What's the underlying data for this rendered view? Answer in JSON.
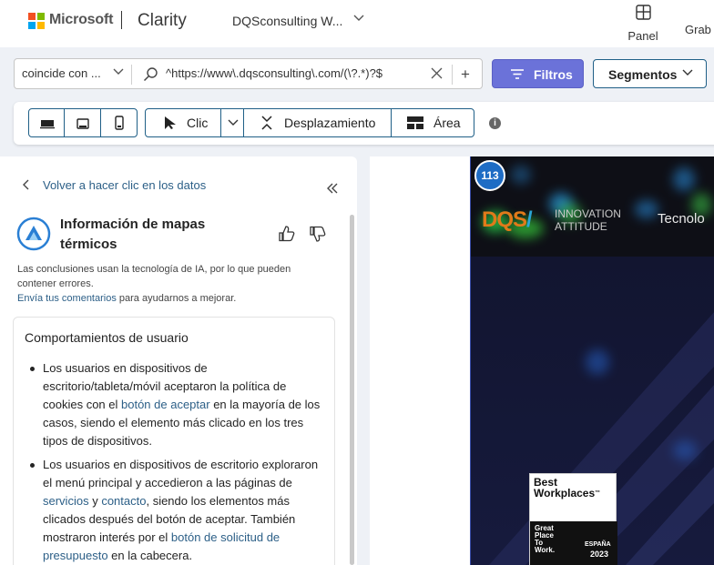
{
  "header": {
    "brand": "Microsoft",
    "product": "Clarity",
    "project_name": "DQSconsulting W...",
    "panel_label": "Panel",
    "recordings_label": "Grab"
  },
  "filters": {
    "match_type": "coincide con ...",
    "url_pattern": "^https://www\\.dqsconsulting\\.com/(\\?.*)?$",
    "add_symbol": "+",
    "filters_button": "Filtros",
    "segments_button": "Segmentos"
  },
  "toolbar": {
    "devices": [
      "desktop",
      "tablet",
      "mobile"
    ],
    "mode_click": "Clic",
    "mode_scroll": "Desplazamiento",
    "mode_area": "Área",
    "info_symbol": "i"
  },
  "panel": {
    "back_label": "Volver a hacer clic en los datos",
    "insights_title": "Información de mapas térmicos",
    "ai_note": "Las conclusiones usan la tecnología de IA, por lo que pueden contener errores.",
    "feedback_link": "Envía tus comentarios",
    "feedback_suffix": " para ayudarnos a mejorar.",
    "card_title": "Comportamientos de usuario",
    "bullet1_a": "Los usuarios en dispositivos de escritorio/tableta/móvil aceptaron la política de cookies con el ",
    "bullet1_link": "botón de aceptar",
    "bullet1_b": " en la mayoría de los casos, siendo el elemento más clicado en los tres tipos de dispositivos.",
    "bullet2_a": "Los usuarios en dispositivos de escritorio exploraron el menú principal y accedieron a las páginas de ",
    "bullet2_link1": "servicios",
    "bullet2_mid": " y ",
    "bullet2_link2": "contacto",
    "bullet2_b": ", siendo los elementos más clicados después del botón de aceptar. También mostraron interés por el ",
    "bullet2_link3": "botón de solicitud de presupuesto",
    "bullet2_c": " en la cabecera."
  },
  "heatmap": {
    "click_count": "113",
    "site_logo_a": "DQS",
    "site_logo_b": "/",
    "tagline_1": "INNOVATION",
    "tagline_2": "ATTITUDE",
    "nav_text": "Tecnolo",
    "badge_title_1": "Best",
    "badge_title_2": "Workplaces",
    "badge_tm": "™",
    "badge_gptw_1": "Great",
    "badge_gptw_2": "Place",
    "badge_gptw_3": "To",
    "badge_gptw_4": "Work.",
    "badge_country": "ESPAÑA",
    "badge_year": "2023"
  },
  "colors": {
    "accent": "#6b72d9",
    "link": "#2c5f87",
    "border": "#1f5f87",
    "heat_blue": "#1e6cc4"
  }
}
